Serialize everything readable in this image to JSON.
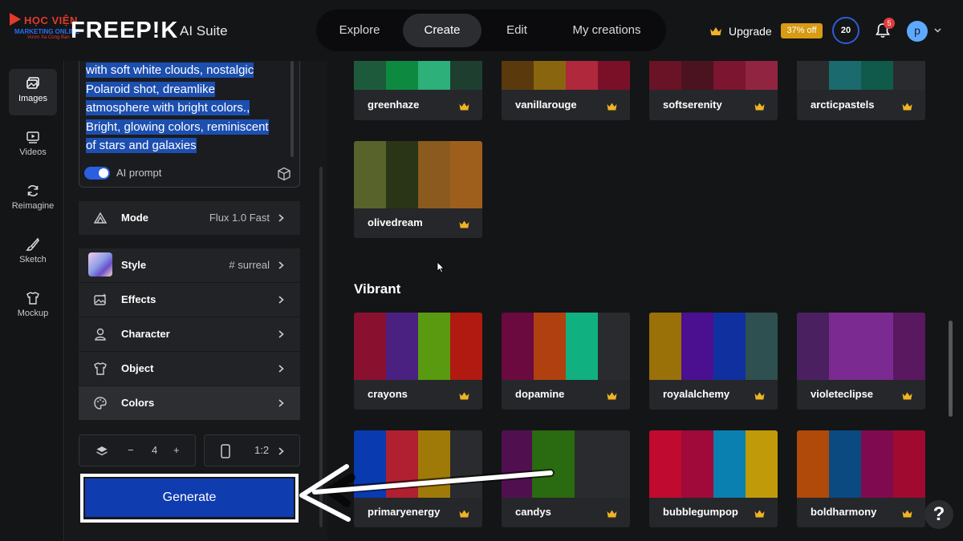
{
  "watermark": {
    "line1": "HỌC VIỆN",
    "line2": "MARKETING ONLINE",
    "line3": "Vươn Xa Cùng Bạn"
  },
  "brand": {
    "name": "FREEP!K",
    "suite": "AI Suite"
  },
  "nav": {
    "tabs": [
      "Explore",
      "Create",
      "Edit",
      "My creations"
    ],
    "active": "Create"
  },
  "header": {
    "upgrade_label": "Upgrade",
    "discount": "37% off",
    "credits": "20",
    "notifications": "5",
    "avatar_initial": "p"
  },
  "rail": {
    "items": [
      {
        "label": "Images",
        "icon": "images-icon"
      },
      {
        "label": "Videos",
        "icon": "videos-icon"
      },
      {
        "label": "Reimagine",
        "icon": "reimagine-icon"
      },
      {
        "label": "Sketch",
        "icon": "sketch-icon"
      },
      {
        "label": "Mockup",
        "icon": "mockup-icon"
      }
    ]
  },
  "prompt": {
    "lines": [
      "with soft white clouds, nostalgic",
      "Polaroid shot, dreamlike",
      "atmosphere with bright colors.,",
      "Bright, glowing colors, reminiscent",
      "of stars and galaxies"
    ],
    "ai_prompt_label": "AI prompt"
  },
  "settings": {
    "mode": {
      "label": "Mode",
      "value": "Flux 1.0 Fast"
    },
    "style": {
      "label": "Style",
      "value": "# surreal"
    },
    "effects": {
      "label": "Effects"
    },
    "character": {
      "label": "Character"
    },
    "object": {
      "label": "Object"
    },
    "colors": {
      "label": "Colors"
    }
  },
  "controls": {
    "minus": "−",
    "count": "4",
    "plus": "+",
    "ratio": "1:2"
  },
  "generate_label": "Generate",
  "gallery": {
    "top_cards": [
      {
        "name": "greenhaze",
        "colors": [
          "#1d5a3b",
          "#0d8a3f",
          "#2db07a",
          "#1e3f30"
        ]
      },
      {
        "name": "vanillarouge",
        "colors": [
          "#5a3a0c",
          "#8a6510",
          "#b0283c",
          "#7a1028"
        ]
      },
      {
        "name": "softserenity",
        "colors": [
          "#6a1326",
          "#4b1320",
          "#7c1530",
          "#912440"
        ]
      },
      {
        "name": "arcticpastels",
        "colors": [
          "#2a2b2e",
          "#1a6a6e",
          "#0f5a4a",
          "#2a2b2e"
        ]
      },
      {
        "name": "olivedream",
        "colors": [
          "#58632c",
          "#2a3417",
          "#8a5a1e",
          "#9e5f1d"
        ]
      }
    ],
    "section_title": "Vibrant",
    "vibrant_row1": [
      {
        "name": "crayons",
        "colors": [
          "#8a1030",
          "#4a2080",
          "#5a9a10",
          "#b01a10"
        ]
      },
      {
        "name": "dopamine",
        "colors": [
          "#6a0a3e",
          "#b04010",
          "#10b080",
          "#2a2b2e"
        ]
      },
      {
        "name": "royalalchemy",
        "colors": [
          "#9a7008",
          "#4a1090",
          "#1030a0",
          "#2e5050"
        ]
      },
      {
        "name": "violeteclipse",
        "colors": [
          "#4a2060",
          "#7a2a90",
          "#7a2a90",
          "#5a1860"
        ]
      }
    ],
    "vibrant_row2": [
      {
        "name": "primaryenergy",
        "colors": [
          "#0a3ab0",
          "#b02030",
          "#a07a08",
          "#2a2b2e"
        ]
      },
      {
        "name": "candys",
        "colors": [
          "#501050",
          "#2a6a10",
          "#2a2b2e"
        ]
      },
      {
        "name": "bubblegumpop",
        "colors": [
          "#c00a30",
          "#a00a3a",
          "#0a80b0",
          "#c09a08"
        ]
      },
      {
        "name": "boldharmony",
        "colors": [
          "#b04a0a",
          "#0a4a80",
          "#800a50",
          "#a00a30"
        ]
      }
    ]
  }
}
